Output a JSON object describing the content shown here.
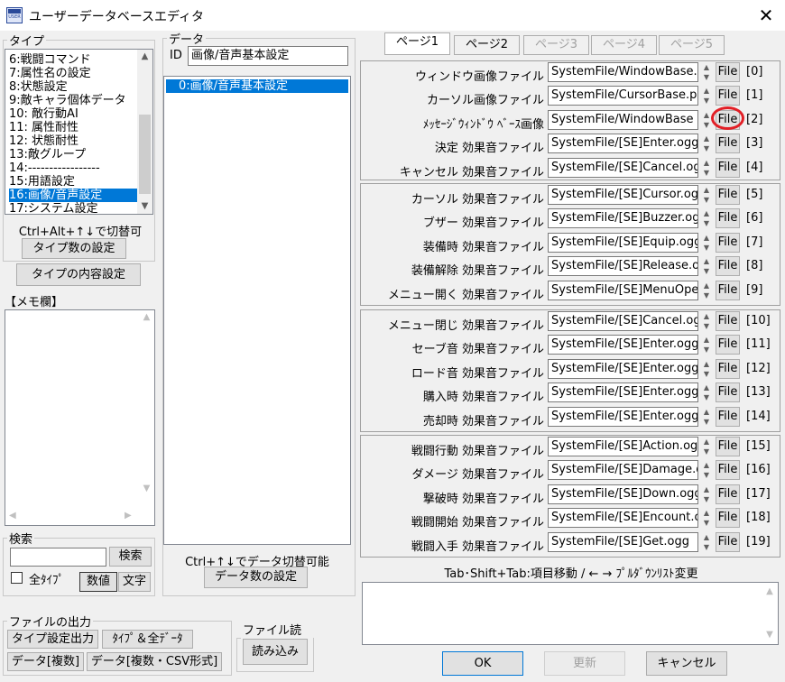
{
  "window": {
    "title": "ユーザーデータベースエディタ"
  },
  "type_group": {
    "legend": "タイプ",
    "items": [
      "6:戦闘コマンド",
      "7:属性名の設定",
      "8:状態設定",
      "9:敵キャラ個体データ",
      "10:  敵行動AI",
      "11:  属性耐性",
      "12:  状態耐性",
      "13:敵グループ",
      "14:-----------------",
      "15:用語設定",
      "16:画像/音声設定",
      "17:システム設定"
    ],
    "selected_index": 10,
    "hint": "Ctrl+Alt+↑↓で切替可",
    "count_button": "タイプ数の設定"
  },
  "type_content_button": "タイプの内容設定",
  "memo_label": "【メモ欄】",
  "search": {
    "legend": "検索",
    "button": "検索",
    "all_types_label": "全ﾀｲﾌﾟ",
    "numeric_button": "数値",
    "text_button": "文字"
  },
  "file_output": {
    "legend": "ファイルの出力",
    "type_settings": "タイプ設定出力",
    "type_all_data": "ﾀｲﾌﾟ＆全ﾃﾞｰﾀ",
    "data_multi": "データ[複数]",
    "data_csv": "データ[複数・CSV形式]"
  },
  "file_read": {
    "legend": "ファイル読込",
    "button": "読み込み"
  },
  "data_group": {
    "legend": "データ",
    "id_label": "ID",
    "id_value": "画像/音声基本設定",
    "items": [
      "0:画像/音声基本設定"
    ],
    "hint": "Ctrl+↑↓でデータ切替可能",
    "count_button": "データ数の設定"
  },
  "tabs": [
    {
      "label": "ページ1",
      "active": true,
      "enabled": true
    },
    {
      "label": "ページ2",
      "active": false,
      "enabled": true
    },
    {
      "label": "ページ3",
      "active": false,
      "enabled": false
    },
    {
      "label": "ページ4",
      "active": false,
      "enabled": false
    },
    {
      "label": "ページ5",
      "active": false,
      "enabled": false
    }
  ],
  "file_button_label": "File",
  "panels": [
    {
      "rows": [
        {
          "label": "ウィンドウ画像ファイル",
          "value": "SystemFile/WindowBase.png",
          "index": "[0]"
        },
        {
          "label": "カーソル画像ファイル",
          "value": "SystemFile/CursorBase.png",
          "index": "[1]"
        },
        {
          "label": "ﾒｯｾｰｼﾞｳｨﾝﾄﾞｳ ﾍﾞｰｽ画像",
          "value": "SystemFile/WindowBase",
          "index": "[2]"
        },
        {
          "label": "決定 効果音ファイル",
          "value": "SystemFile/[SE]Enter.ogg",
          "index": "[3]"
        },
        {
          "label": "キャンセル 効果音ファイル",
          "value": "SystemFile/[SE]Cancel.ogg",
          "index": "[4]"
        }
      ]
    },
    {
      "rows": [
        {
          "label": "カーソル 効果音ファイル",
          "value": "SystemFile/[SE]Cursor.ogg",
          "index": "[5]"
        },
        {
          "label": "ブザー 効果音ファイル",
          "value": "SystemFile/[SE]Buzzer.ogg",
          "index": "[6]"
        },
        {
          "label": "装備時 効果音ファイル",
          "value": "SystemFile/[SE]Equip.ogg",
          "index": "[7]"
        },
        {
          "label": "装備解除 効果音ファイル",
          "value": "SystemFile/[SE]Release.ogg",
          "index": "[8]"
        },
        {
          "label": "メニュー開く 効果音ファイル",
          "value": "SystemFile/[SE]MenuOpen.ogg",
          "index": "[9]"
        }
      ]
    },
    {
      "rows": [
        {
          "label": "メニュー閉じ 効果音ファイル",
          "value": "SystemFile/[SE]Cancel.ogg",
          "index": "[10]"
        },
        {
          "label": "セーブ音 効果音ファイル",
          "value": "SystemFile/[SE]Enter.ogg",
          "index": "[11]"
        },
        {
          "label": "ロード音 効果音ファイル",
          "value": "SystemFile/[SE]Enter.ogg",
          "index": "[12]"
        },
        {
          "label": "購入時 効果音ファイル",
          "value": "SystemFile/[SE]Enter.ogg",
          "index": "[13]"
        },
        {
          "label": "売却時 効果音ファイル",
          "value": "SystemFile/[SE]Enter.ogg",
          "index": "[14]"
        }
      ]
    },
    {
      "rows": [
        {
          "label": "戦闘行動 効果音ファイル",
          "value": "SystemFile/[SE]Action.ogg",
          "index": "[15]"
        },
        {
          "label": "ダメージ 効果音ファイル",
          "value": "SystemFile/[SE]Damage.ogg",
          "index": "[16]"
        },
        {
          "label": "撃破時 効果音ファイル",
          "value": "SystemFile/[SE]Down.ogg",
          "index": "[17]"
        },
        {
          "label": "戦闘開始 効果音ファイル",
          "value": "SystemFile/[SE]Encount.ogg",
          "index": "[18]"
        },
        {
          "label": "戦闘入手 効果音ファイル",
          "value": "SystemFile/[SE]Get.ogg",
          "index": "[19]"
        }
      ]
    }
  ],
  "nav_hint": "Tab･Shift+Tab:項目移動 / ← → ﾌﾟﾙﾀﾞｳﾝﾘｽﾄ変更",
  "buttons": {
    "ok": "OK",
    "update": "更新",
    "cancel": "キャンセル"
  }
}
